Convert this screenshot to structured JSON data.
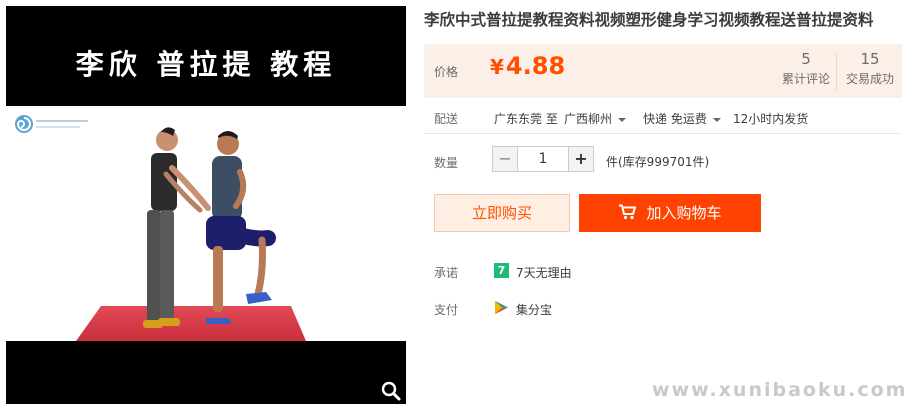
{
  "gallery": {
    "banner_title": "李欣 普拉提 教程",
    "zoom_icon": "magnifier-icon",
    "logo_icon": "swirl-logo-icon"
  },
  "product": {
    "title": "李欣中式普拉提教程资料视频塑形健身学习视频教程送普拉提资料"
  },
  "price": {
    "label": "价格",
    "currency": "¥",
    "amount": "4.88",
    "color": "#ff5000"
  },
  "stats": [
    {
      "count": "5",
      "label": "累计评论"
    },
    {
      "count": "15",
      "label": "交易成功"
    }
  ],
  "shipping": {
    "label": "配送",
    "origin": "广东东莞 至",
    "destination": "广西柳州",
    "method": "快递 免运费",
    "dispatch": "12小时内发货"
  },
  "quantity": {
    "label": "数量",
    "minus": "−",
    "value": "1",
    "plus": "+",
    "stock": "件(库存999701件)"
  },
  "actions": {
    "buy_now": "立即购买",
    "add_to_cart": "加入购物车",
    "cart_icon": "cart-icon",
    "accent": "#ff4200"
  },
  "promise": {
    "label": "承诺",
    "badge": "7",
    "text": "7天无理由"
  },
  "payment": {
    "label": "支付",
    "icon": "jifenbao-icon",
    "text": "集分宝"
  },
  "watermark": "www.xunibaoku.com"
}
